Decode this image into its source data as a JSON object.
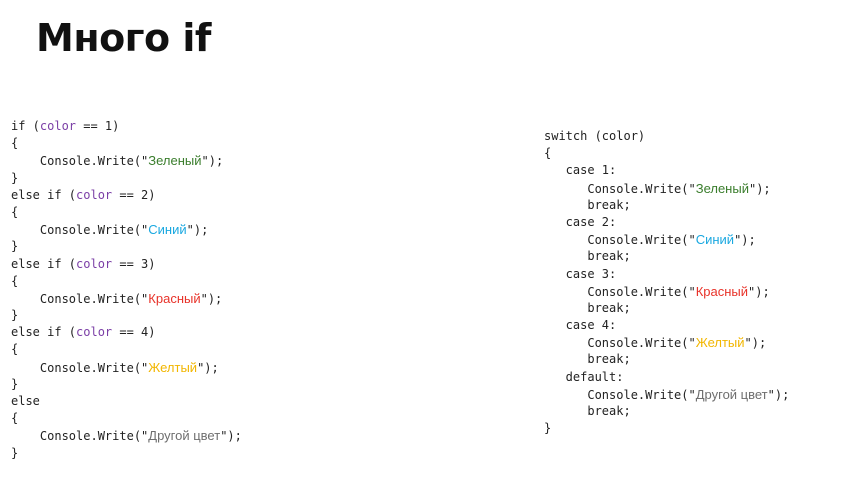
{
  "title": "Много if",
  "colors": {
    "text": "#222222",
    "variable": "#7b3fa6",
    "green": "#3a7d2c",
    "blue": "#1aa8e0",
    "red": "#e8332a",
    "yellow": "#f2b600",
    "gray": "#6e6e6e"
  },
  "left_code": {
    "lines": [
      [
        {
          "t": "if ("
        },
        {
          "t": "color",
          "c": "variable"
        },
        {
          "t": " == 1)"
        }
      ],
      [
        {
          "t": "{"
        }
      ],
      [
        {
          "t": "    Console.Write(\""
        },
        {
          "t": "Зеленый",
          "c": "green",
          "s": 1
        },
        {
          "t": "\");"
        }
      ],
      [
        {
          "t": "}"
        }
      ],
      [
        {
          "t": "else if ("
        },
        {
          "t": "color",
          "c": "variable"
        },
        {
          "t": " == 2)"
        }
      ],
      [
        {
          "t": "{"
        }
      ],
      [
        {
          "t": "    Console.Write(\""
        },
        {
          "t": "Синий",
          "c": "blue",
          "s": 1
        },
        {
          "t": "\");"
        }
      ],
      [
        {
          "t": "}"
        }
      ],
      [
        {
          "t": "else if ("
        },
        {
          "t": "color",
          "c": "variable"
        },
        {
          "t": " == 3)"
        }
      ],
      [
        {
          "t": "{"
        }
      ],
      [
        {
          "t": "    Console.Write(\""
        },
        {
          "t": "Красный",
          "c": "red",
          "s": 1
        },
        {
          "t": "\");"
        }
      ],
      [
        {
          "t": "}"
        }
      ],
      [
        {
          "t": "else if ("
        },
        {
          "t": "color",
          "c": "variable"
        },
        {
          "t": " == 4)"
        }
      ],
      [
        {
          "t": "{"
        }
      ],
      [
        {
          "t": "    Console.Write(\""
        },
        {
          "t": "Желтый",
          "c": "yellow",
          "s": 1
        },
        {
          "t": "\");"
        }
      ],
      [
        {
          "t": "}"
        }
      ],
      [
        {
          "t": "else"
        }
      ],
      [
        {
          "t": "{"
        }
      ],
      [
        {
          "t": "    Console.Write(\""
        },
        {
          "t": "Другой цвет",
          "c": "gray",
          "s": 1
        },
        {
          "t": "\");"
        }
      ],
      [
        {
          "t": "}"
        }
      ]
    ]
  },
  "right_code": {
    "lines": [
      [
        {
          "t": "switch (color)"
        }
      ],
      [
        {
          "t": "{"
        }
      ],
      [
        {
          "t": "   case 1:"
        }
      ],
      [
        {
          "t": "      Console.Write(\""
        },
        {
          "t": "Зеленый",
          "c": "green",
          "s": 1
        },
        {
          "t": "\");"
        }
      ],
      [
        {
          "t": "      break;"
        }
      ],
      [
        {
          "t": "   case 2:"
        }
      ],
      [
        {
          "t": "      Console.Write(\""
        },
        {
          "t": "Синий",
          "c": "blue",
          "s": 1
        },
        {
          "t": "\");"
        }
      ],
      [
        {
          "t": "      break;"
        }
      ],
      [
        {
          "t": "   case 3:"
        }
      ],
      [
        {
          "t": "      Console.Write(\""
        },
        {
          "t": "Красный",
          "c": "red",
          "s": 1
        },
        {
          "t": "\");"
        }
      ],
      [
        {
          "t": "      break;"
        }
      ],
      [
        {
          "t": "   case 4:"
        }
      ],
      [
        {
          "t": "      Console.Write(\""
        },
        {
          "t": "Желтый",
          "c": "yellow",
          "s": 1
        },
        {
          "t": "\");"
        }
      ],
      [
        {
          "t": "      break;"
        }
      ],
      [
        {
          "t": "   default:"
        }
      ],
      [
        {
          "t": "      Console.Write(\""
        },
        {
          "t": "Другой цвет",
          "c": "gray",
          "s": 1
        },
        {
          "t": "\");"
        }
      ],
      [
        {
          "t": "      break;"
        }
      ],
      [
        {
          "t": "}"
        }
      ]
    ]
  }
}
